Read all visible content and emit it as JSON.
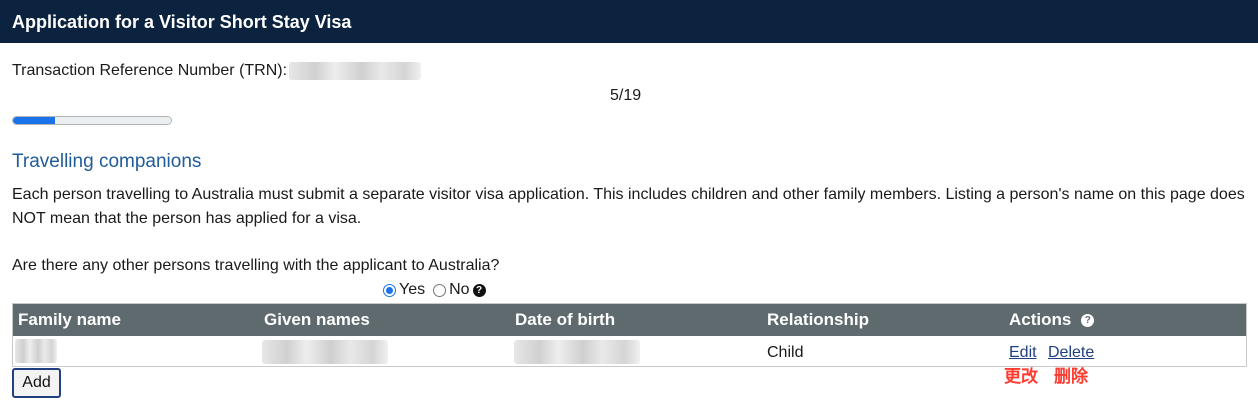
{
  "header": {
    "title": "Application for a Visitor Short Stay Visa"
  },
  "trn": {
    "label": "Transaction Reference Number (TRN):"
  },
  "progress": {
    "step_text": "5/19",
    "fraction": 0.263
  },
  "section": {
    "title": "Travelling companions",
    "description": "Each person travelling to Australia must submit a separate visitor visa application. This includes children and other family members. Listing a person's name on this page does NOT mean that the person has applied for a visa."
  },
  "question": {
    "text": "Are there any other persons travelling with the applicant to Australia?",
    "options": {
      "yes": "Yes",
      "no": "No"
    },
    "selected": "Yes"
  },
  "table": {
    "headers": {
      "family_name": "Family name",
      "given_names": "Given names",
      "dob": "Date of birth",
      "relationship": "Relationship",
      "actions": "Actions"
    },
    "rows": [
      {
        "relationship": "Child",
        "edit": "Edit",
        "delete": "Delete"
      }
    ]
  },
  "annotations": {
    "edit": "更改",
    "delete": "删除"
  },
  "buttons": {
    "add": "Add"
  },
  "icons": {
    "help": "question-circle-icon"
  },
  "colors": {
    "header_bg": "#0c2340",
    "table_header_bg": "#5e6a6e",
    "accent": "#1a73e8",
    "section_title": "#1f5c9a",
    "annotation": "#ff3b30"
  }
}
